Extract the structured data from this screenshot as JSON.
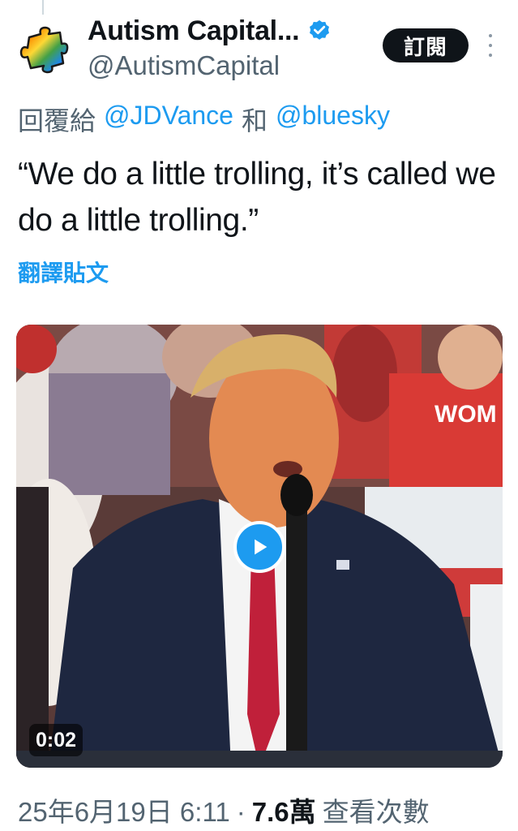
{
  "author": {
    "display_name": "Autism Capital...",
    "handle": "@AutismCapital",
    "avatar_icon": "rainbow-puzzle-piece-icon",
    "verified_icon": "verified-badge-icon",
    "verified_color": "#1d9bf0"
  },
  "header": {
    "subscribe_label": "訂閱",
    "more_icon": "more-vertical-icon"
  },
  "reply": {
    "prefix": "回覆給",
    "mention_1": "@JDVance",
    "joiner": "和",
    "mention_2": "@bluesky"
  },
  "tweet": {
    "text": "“We do a little trolling, it’s called we do a little trolling.”",
    "translate_label": "翻譯貼文"
  },
  "media": {
    "type": "video",
    "duration": "0:02",
    "play_icon": "play-icon",
    "background_sign_text": "WOM"
  },
  "meta": {
    "timestamp": "25年6月19日 6:11",
    "separator": "·",
    "views_count": "7.6萬",
    "views_label": "查看次數"
  },
  "colors": {
    "accent": "#1d9bf0",
    "text_primary": "#0f1419",
    "text_secondary": "#536471"
  }
}
